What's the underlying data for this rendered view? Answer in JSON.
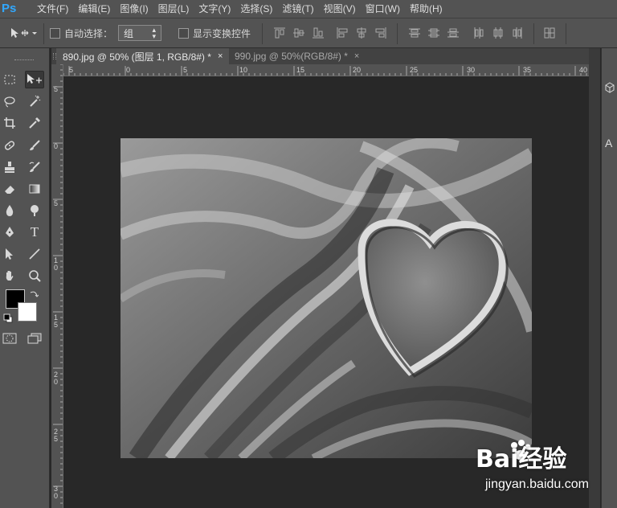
{
  "app": {
    "logo": "Ps"
  },
  "menu": [
    "文件(F)",
    "编辑(E)",
    "图像(I)",
    "图层(L)",
    "文字(Y)",
    "选择(S)",
    "滤镜(T)",
    "视图(V)",
    "窗口(W)",
    "帮助(H)"
  ],
  "options": {
    "auto_select_label": "自动选择：",
    "auto_select_value": "组",
    "show_transform_label": "显示变换控件"
  },
  "tabs": [
    {
      "label": "890.jpg @ 50% (图层 1, RGB/8#) *",
      "close": "×"
    },
    {
      "label": "990.jpg @ 50%(RGB/8#) *",
      "close": "×"
    }
  ],
  "ruler": {
    "h_labels": [
      "5",
      "0",
      "5",
      "10",
      "15",
      "20",
      "25",
      "30",
      "35",
      "40"
    ],
    "v_labels": [
      "5",
      "0",
      "5",
      "1\n0",
      "1\n5",
      "2\n0",
      "2\n5",
      "3\n0"
    ]
  },
  "tools": [
    "marquee-icon",
    "move-icon",
    "lasso-icon",
    "magic-wand-icon",
    "crop-icon",
    "eyedropper-icon",
    "healing-brush-icon",
    "brush-icon",
    "clone-stamp-icon",
    "history-brush-icon",
    "eraser-icon",
    "gradient-icon",
    "blur-icon",
    "dodge-icon",
    "pen-icon",
    "type-icon",
    "path-selection-icon",
    "line-icon",
    "hand-icon",
    "zoom-icon",
    "quick-mask-icon",
    "screen-mode-icon"
  ],
  "tool_glyphs": {
    "type": "T"
  },
  "right_panel": {
    "label": "A"
  },
  "watermark": {
    "logo": "Bai经验",
    "url": "jingyan.baidu.com"
  },
  "colors": {
    "foreground": "#000000",
    "background": "#ffffff",
    "ui": "#535353",
    "canvas_bg": "#282828"
  }
}
